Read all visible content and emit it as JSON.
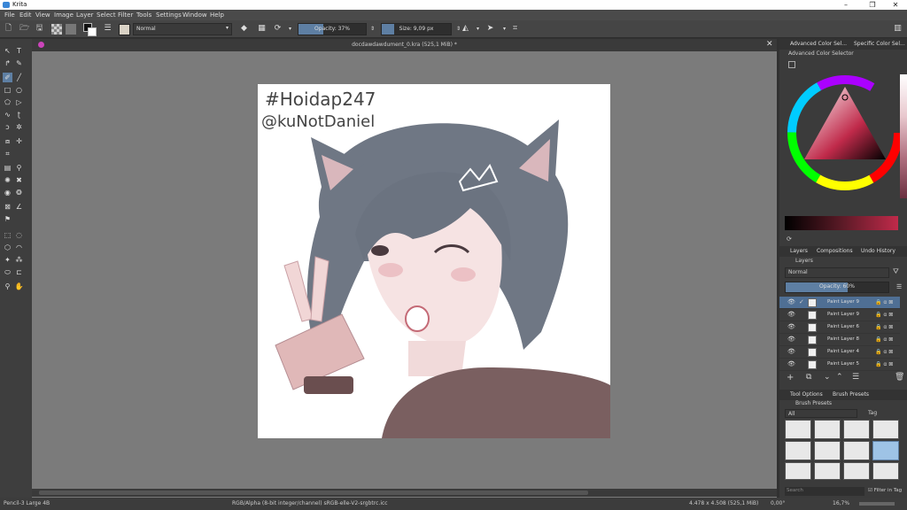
{
  "window": {
    "title": "Krita",
    "min": "–",
    "max": "❐",
    "close": "✕"
  },
  "menu": [
    "File",
    "Edit",
    "View",
    "Image",
    "Layer",
    "Select",
    "Filter",
    "Tools",
    "Settings",
    "Window",
    "Help"
  ],
  "toolbar": {
    "blend_mode": "Normal",
    "opacity_label": "Opacity: 37%",
    "opacity_value": 0.37,
    "size_label": "Size: 9,09 px"
  },
  "document": {
    "tab_name": "docdawdawdument_0.kra (525,1 MiB) *",
    "close": "✕"
  },
  "artwork_text": {
    "line1": "#Hoidap247",
    "line2": "@kuNotDaniel"
  },
  "status": {
    "brush": "Pencil-3 Large 4B",
    "color_model": "RGB/Alpha (8-bit integer/channel)  sRGB-elle-V2-srgbtrc.icc",
    "dimensions": "4.478 x 4.508 (525,1 MiB)",
    "rotation": "0,00°",
    "zoom": "16,7%"
  },
  "color_panel": {
    "tabs": [
      "Advanced Color Sel...",
      "Specific Color Sel..."
    ],
    "title": "Advanced Color Selector"
  },
  "layers_panel": {
    "tabs": [
      "Layers",
      "Compositions",
      "Undo History"
    ],
    "title": "Layers",
    "blend_mode": "Normal",
    "opacity_label": "Opacity: 60%",
    "opacity_value": 0.6,
    "layers": [
      {
        "name": "Paint Layer 9",
        "selected": true
      },
      {
        "name": "Paint Layer 9",
        "selected": false
      },
      {
        "name": "Paint Layer 6",
        "selected": false
      },
      {
        "name": "Paint Layer 8",
        "selected": false
      },
      {
        "name": "Paint Layer 4",
        "selected": false
      },
      {
        "name": "Paint Layer 5",
        "selected": false
      }
    ]
  },
  "brush_panel": {
    "tabs": [
      "Tool Options",
      "Brush Presets"
    ],
    "title": "Brush Presets",
    "filter": "All",
    "tag_label": "Tag",
    "search_placeholder": "Search",
    "filter_in_tag": "Filter in Tag"
  },
  "colors": {
    "accent": "#5e7fa3",
    "canvas_bg": "#7b7b7b",
    "panel_bg": "#3b3b3b",
    "selected_layer": "#4f6f94"
  }
}
